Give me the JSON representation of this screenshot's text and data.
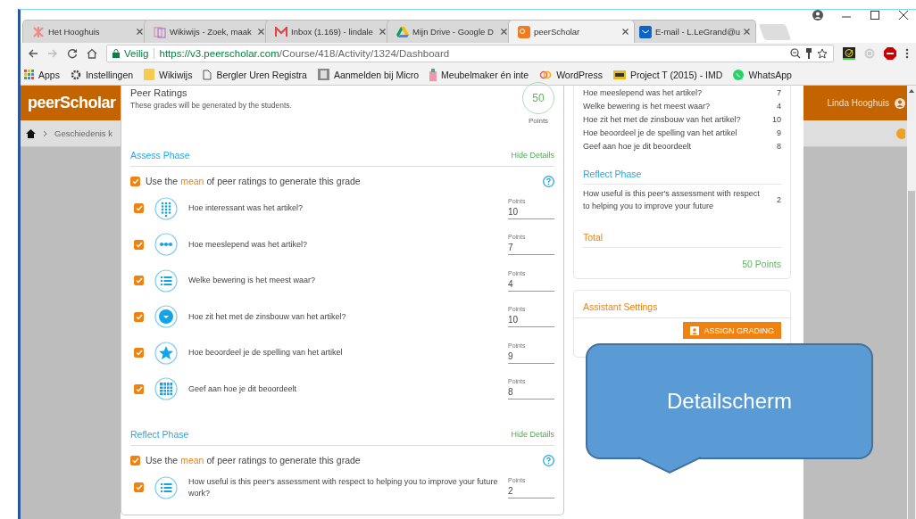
{
  "browser": {
    "tabs": [
      {
        "title": "Het Hooghuis",
        "kind": "star",
        "selected": false
      },
      {
        "title": "Wikiwijs - Zoek, maak",
        "kind": "pages",
        "selected": false
      },
      {
        "title": "Inbox (1.169) - lindale",
        "kind": "mail",
        "selected": false
      },
      {
        "title": "Mijn Drive - Google D",
        "kind": "drive",
        "selected": false
      },
      {
        "title": "peerScholar",
        "kind": "ps",
        "selected": true
      },
      {
        "title": "E-mail - L.LeGrand@u",
        "kind": "outlook",
        "selected": false
      }
    ],
    "address": {
      "secure_label": "Veilig",
      "host": "https://v3.peerscholar.com",
      "path": "/Course/418/Activity/1324/Dashboard"
    },
    "bookmarks": [
      {
        "label": "Apps",
        "kind": "apps"
      },
      {
        "label": "Instellingen",
        "kind": "gear"
      },
      {
        "label": "Wikiwijs",
        "kind": "folder"
      },
      {
        "label": "Bergler Uren Registra",
        "kind": "page"
      },
      {
        "label": "Aanmelden bij Micro",
        "kind": "photo"
      },
      {
        "label": "Meubelmaker én inte",
        "kind": "bottle"
      },
      {
        "label": "WordPress",
        "kind": "links"
      },
      {
        "label": "Project T (2015) - IMD",
        "kind": "imdb"
      },
      {
        "label": "WhatsApp",
        "kind": "whatsapp"
      }
    ]
  },
  "app": {
    "logo": "peerScholar",
    "breadcrumb": "Geschiedenis k",
    "user": "Linda Hooghuis"
  },
  "peer_ratings": {
    "title": "Peer Ratings",
    "subtitle": "These grades will be generated by the students.",
    "points": "50",
    "points_label": "Points"
  },
  "phases": [
    {
      "title": "Assess Phase",
      "toggle": "Hide Details",
      "rule": {
        "checked": true,
        "before": "Use the",
        "highlight": "mean",
        "after": "of peer ratings to generate this grade"
      },
      "questions": [
        {
          "checked": true,
          "kind": "scale",
          "text": "Hoe interessant was het artikel?",
          "points_label": "Points",
          "points": "10"
        },
        {
          "checked": true,
          "kind": "dots",
          "text": "Hoe meeslepend was het artikel?",
          "points_label": "Points",
          "points": "7"
        },
        {
          "checked": true,
          "kind": "list",
          "text": "Welke bewering is het meest waar?",
          "points_label": "Points",
          "points": "4"
        },
        {
          "checked": true,
          "kind": "dropdown",
          "text": "Hoe zit het met de zinsbouw van het artikel?",
          "points_label": "Points",
          "points": "10"
        },
        {
          "checked": true,
          "kind": "star",
          "text": "Hoe beoordeel je de spelling van het artikel",
          "points_label": "Points",
          "points": "9"
        },
        {
          "checked": true,
          "kind": "grid",
          "text": "Geef aan hoe je dit beoordeelt",
          "points_label": "Points",
          "points": "8"
        }
      ]
    },
    {
      "title": "Reflect Phase",
      "toggle": "Hide Details",
      "rule": {
        "checked": true,
        "before": "Use the",
        "highlight": "mean",
        "after": "of peer ratings to generate this grade"
      },
      "questions": [
        {
          "checked": true,
          "kind": "list",
          "text": "How useful is this peer's assessment with respect to helping you to improve your future work?",
          "points_label": "Points",
          "points": "2"
        }
      ]
    }
  ],
  "summary": {
    "assess_rows": [
      {
        "text": "Hoe meeslepend was het artikel?",
        "value": "7"
      },
      {
        "text": "Welke bewering is het meest waar?",
        "value": "4"
      },
      {
        "text": "Hoe zit het met de zinsbouw van het artikel?",
        "value": "10"
      },
      {
        "text": "Hoe beoordeel je de spelling van het artikel",
        "value": "9"
      },
      {
        "text": "Geef aan hoe je dit beoordeelt",
        "value": "8"
      }
    ],
    "reflect_title": "Reflect Phase",
    "reflect_rows": [
      {
        "text": "How useful is this peer's assessment with respect to helping you to improve your future",
        "value": "2"
      }
    ],
    "total_title": "Total",
    "total": "50 Points"
  },
  "assistant": {
    "title": "Assistant Settings",
    "button": "ASSIGN GRADING"
  },
  "callout": {
    "text": "Detailscherm"
  }
}
